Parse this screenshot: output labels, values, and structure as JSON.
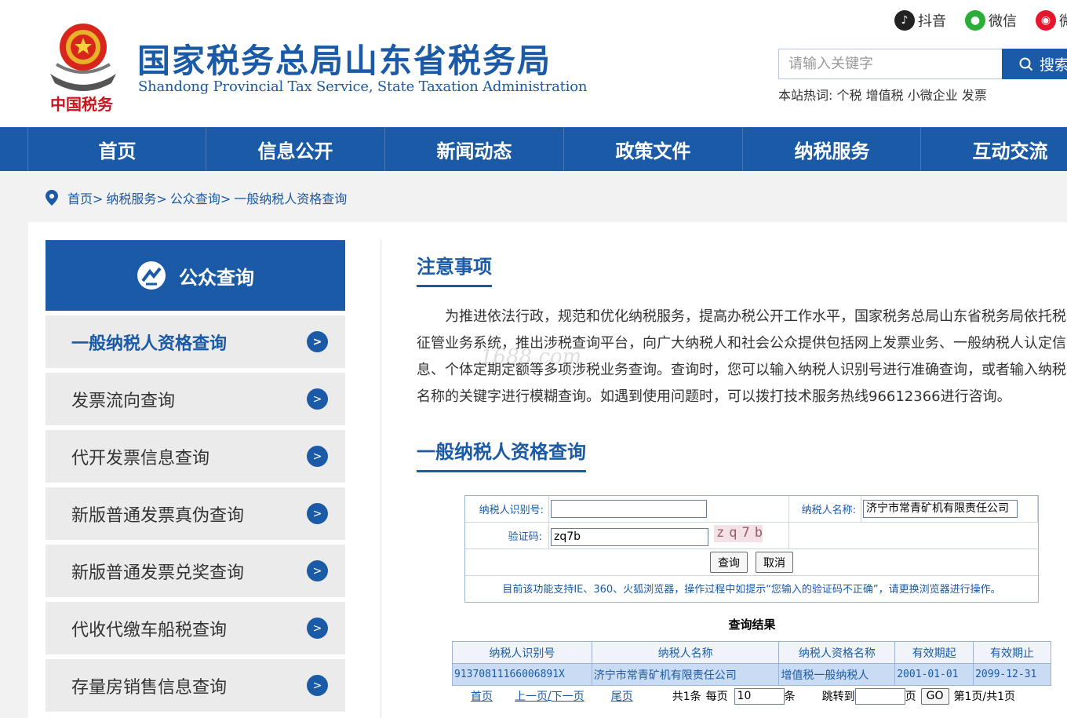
{
  "header": {
    "title": "国家税务总局山东省税务局",
    "subtitle": "Shandong Provincial Tax Service, State Taxation Administration",
    "emblem_text": "中国税务",
    "social": [
      {
        "label": "抖音",
        "icon": "douyin-icon",
        "color": "#222222"
      },
      {
        "label": "微信",
        "icon": "wechat-icon",
        "color": "#2aae38"
      },
      {
        "label": "微",
        "icon": "weibo-icon",
        "color": "#e6162d"
      }
    ],
    "search": {
      "placeholder": "请输入关键字",
      "button": "搜索"
    },
    "hotwords_label": "本站热词:",
    "hotwords": [
      "个税",
      "增值税",
      "小微企业",
      "发票"
    ]
  },
  "nav": [
    "首页",
    "信息公开",
    "新闻动态",
    "政策文件",
    "纳税服务",
    "互动交流"
  ],
  "breadcrumb": [
    "首页>",
    "纳税服务>",
    "公众查询>",
    "一般纳税人资格查询"
  ],
  "sidebar": {
    "title": "公众查询",
    "items": [
      "一般纳税人资格查询",
      "发票流向查询",
      "代开发票信息查询",
      "新版普通发票真伪查询",
      "新版普通发票兑奖查询",
      "代收代缴车船税查询",
      "存量房销售信息查询"
    ]
  },
  "notice": {
    "title": "注意事项",
    "lines": [
      "为推进依法行政，规范和优化纳税服务，提高办税公开工作水平，国家税务总局山东省税务局依托税",
      "征管业务系统，推出涉税查询平台，向广大纳税人和社会公众提供包括网上发票业务、一般纳税人认定信",
      "息、个体定期定额等多项涉税业务查询。查询时，您可以输入纳税人识别号进行准确查询，或者输入纳税",
      "名称的关键字进行模糊查询。如遇到使用问题时，可以拨打技术服务热线96612366进行咨询。"
    ],
    "watermark": "1688.com"
  },
  "query": {
    "title": "一般纳税人资格查询",
    "taxpayer_id_label": "纳税人识别号:",
    "taxpayer_id_value": "",
    "taxpayer_name_label": "纳税人名称:",
    "taxpayer_name_value": "济宁市常青矿机有限责任公司",
    "captcha_label": "验证码:",
    "captcha_value": "zq7b",
    "captcha_image_text": "zq7b",
    "submit": "查询",
    "cancel": "取消",
    "note": "目前该功能支持IE、360、火狐浏览器，操作过程中如提示“您输入的验证码不正确”，请更换浏览器进行操作。"
  },
  "results": {
    "title": "查询结果",
    "columns": [
      "纳税人识别号",
      "纳税人名称",
      "纳税人资格名称",
      "有效期起",
      "有效期止"
    ],
    "rows": [
      [
        "91370811166006891X",
        "济宁市常青矿机有限责任公司",
        "增值税一般纳税人",
        "2001-01-01",
        "2099-12-31"
      ]
    ],
    "pager": {
      "first": "首页",
      "prev": "上一页",
      "sep": "/",
      "next": "下一页",
      "last": "尾页",
      "total": "共1条",
      "per_page_label": "每页",
      "per_page_value": "10",
      "per_page_unit": "条",
      "jump_label": "跳转到",
      "jump_value": "",
      "page_unit": "页",
      "go": "GO",
      "status": "第1页/共1页"
    }
  }
}
